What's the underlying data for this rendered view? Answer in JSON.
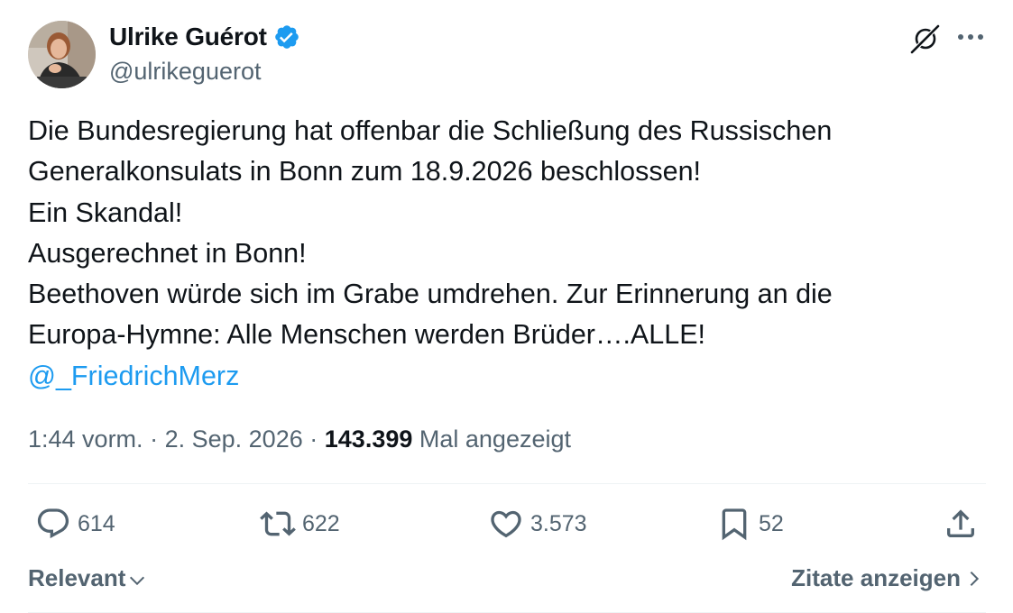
{
  "author": {
    "name": "Ulrike Guérot",
    "handle": "@ulrikeguerot",
    "verified": true
  },
  "tweet": {
    "lines": [
      "Die Bundesregierung hat offenbar die Schließung des Russischen",
      "Generalkonsulats in Bonn zum 18.9.2026 beschlossen!",
      "Ein Skandal!",
      "Ausgerechnet in Bonn!",
      "Beethoven würde sich im Grabe umdrehen. Zur Erinnerung an die",
      "Europa-Hymne: Alle Menschen werden Brüder….ALLE!"
    ],
    "mention": "@_FriedrichMerz",
    "time": "1:44 vorm.",
    "separator": "·",
    "date": "2. Sep. 2026",
    "views": "143.399",
    "views_label": "Mal angezeigt"
  },
  "actions": {
    "reply_count": "614",
    "retweet_count": "622",
    "like_count": "3.573",
    "bookmark_count": "52"
  },
  "footer": {
    "sort_label": "Relevant",
    "quotes_label": "Zitate anzeigen"
  },
  "icons": {
    "verified": "verified-badge-icon",
    "grok": "grok-icon",
    "more": "more-icon",
    "reply": "reply-icon",
    "retweet": "retweet-icon",
    "like": "heart-icon",
    "bookmark": "bookmark-icon",
    "share": "share-icon"
  },
  "colors": {
    "accent": "#1d9bf0",
    "text": "#0f1419",
    "secondary": "#536471",
    "divider": "#eff3f4"
  }
}
